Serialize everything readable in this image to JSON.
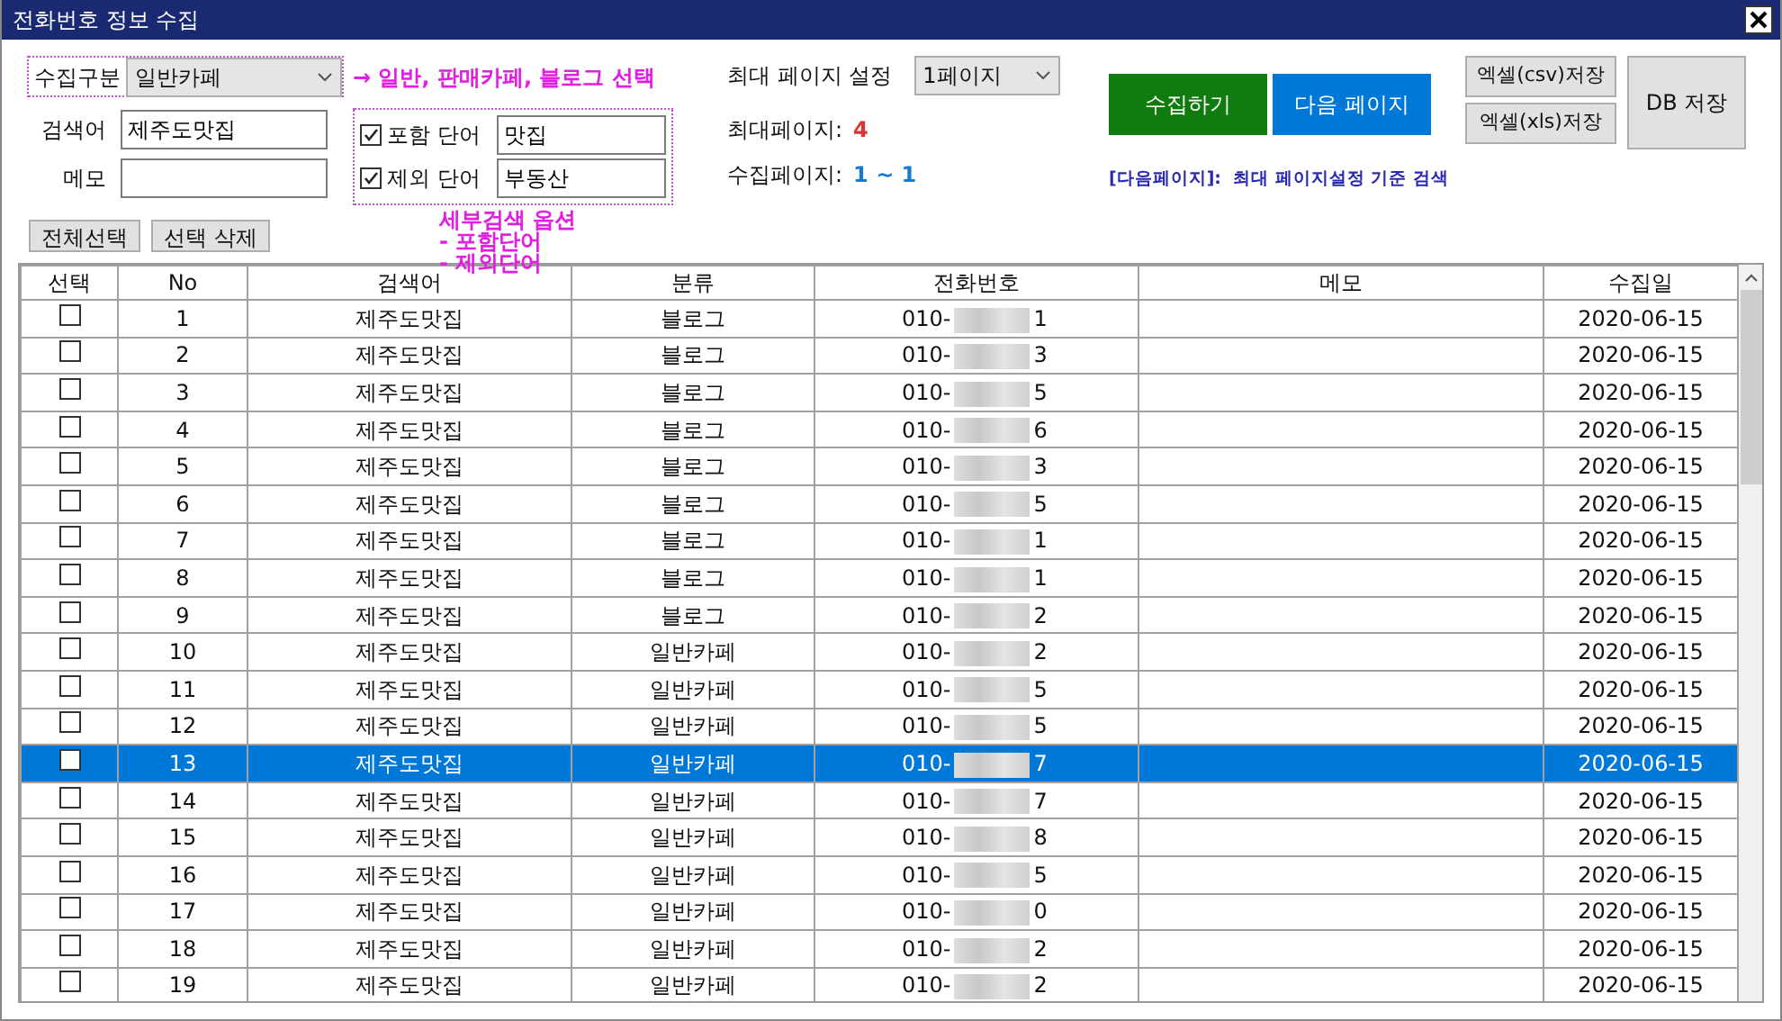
{
  "window": {
    "title": "전화번호 정보 수집"
  },
  "category": {
    "label": "수집구분",
    "value": "일반카페"
  },
  "category_note": "→ 일반, 판매카페, 블로그 선택",
  "keyword": {
    "label": "검색어",
    "value": "제주도맛집"
  },
  "memo": {
    "label": "메모"
  },
  "word_filters": [
    {
      "label": "포함 단어",
      "checked": true,
      "value": "맛집"
    },
    {
      "label": "제외 단어",
      "checked": true,
      "value": "부동산"
    }
  ],
  "detail_note": [
    "세부검색 옵션",
    "- 포함단어",
    "- 제외단어"
  ],
  "max_page_setting": {
    "label": "최대 페이지 설정",
    "value": "1페이지"
  },
  "max_page": {
    "label": "최대페이지:",
    "value": "4"
  },
  "collect_pages": {
    "label": "수집페이지:",
    "value": "1 ~ 1"
  },
  "collect_button": "수집하기",
  "next_button": "다음 페이지",
  "next_note": "[다음페이지]:  최대 페이지설정 기준 검색",
  "excel_csv_button": "엑셀(csv)저장",
  "excel_xls_button": "엑셀(xls)저장",
  "db_button": "DB 저장",
  "select_all_button": "전체선택",
  "delete_button": "선택 삭제",
  "table": {
    "columns": [
      "선택",
      "No",
      "검색어",
      "분류",
      "전화번호",
      "메모",
      "수집일"
    ],
    "rows": [
      {
        "checked": false,
        "selected": false,
        "no": "1",
        "keyword": "제주도맛집",
        "category": "블로그",
        "phone_prefix": "010-",
        "phone_suffix": "1",
        "date": "2020-06-15"
      },
      {
        "checked": false,
        "selected": false,
        "no": "2",
        "keyword": "제주도맛집",
        "category": "블로그",
        "phone_prefix": "010-",
        "phone_suffix": "3",
        "date": "2020-06-15"
      },
      {
        "checked": false,
        "selected": false,
        "no": "3",
        "keyword": "제주도맛집",
        "category": "블로그",
        "phone_prefix": "010-",
        "phone_suffix": "5",
        "date": "2020-06-15"
      },
      {
        "checked": false,
        "selected": false,
        "no": "4",
        "keyword": "제주도맛집",
        "category": "블로그",
        "phone_prefix": "010-",
        "phone_suffix": "6",
        "date": "2020-06-15"
      },
      {
        "checked": false,
        "selected": false,
        "no": "5",
        "keyword": "제주도맛집",
        "category": "블로그",
        "phone_prefix": "010-",
        "phone_suffix": "3",
        "date": "2020-06-15"
      },
      {
        "checked": false,
        "selected": false,
        "no": "6",
        "keyword": "제주도맛집",
        "category": "블로그",
        "phone_prefix": "010-",
        "phone_suffix": "5",
        "date": "2020-06-15"
      },
      {
        "checked": false,
        "selected": false,
        "no": "7",
        "keyword": "제주도맛집",
        "category": "블로그",
        "phone_prefix": "010-",
        "phone_suffix": "1",
        "date": "2020-06-15"
      },
      {
        "checked": false,
        "selected": false,
        "no": "8",
        "keyword": "제주도맛집",
        "category": "블로그",
        "phone_prefix": "010-",
        "phone_suffix": "1",
        "date": "2020-06-15"
      },
      {
        "checked": false,
        "selected": false,
        "no": "9",
        "keyword": "제주도맛집",
        "category": "블로그",
        "phone_prefix": "010-",
        "phone_suffix": "2",
        "date": "2020-06-15"
      },
      {
        "checked": false,
        "selected": false,
        "no": "10",
        "keyword": "제주도맛집",
        "category": "일반카페",
        "phone_prefix": "010-",
        "phone_suffix": "2",
        "date": "2020-06-15"
      },
      {
        "checked": false,
        "selected": false,
        "no": "11",
        "keyword": "제주도맛집",
        "category": "일반카페",
        "phone_prefix": "010-",
        "phone_suffix": "5",
        "date": "2020-06-15"
      },
      {
        "checked": false,
        "selected": false,
        "no": "12",
        "keyword": "제주도맛집",
        "category": "일반카페",
        "phone_prefix": "010-",
        "phone_suffix": "5",
        "date": "2020-06-15"
      },
      {
        "checked": false,
        "selected": true,
        "no": "13",
        "keyword": "제주도맛집",
        "category": "일반카페",
        "phone_prefix": "010-",
        "phone_suffix": "7",
        "date": "2020-06-15"
      },
      {
        "checked": false,
        "selected": false,
        "no": "14",
        "keyword": "제주도맛집",
        "category": "일반카페",
        "phone_prefix": "010-",
        "phone_suffix": "7",
        "date": "2020-06-15"
      },
      {
        "checked": false,
        "selected": false,
        "no": "15",
        "keyword": "제주도맛집",
        "category": "일반카페",
        "phone_prefix": "010-",
        "phone_suffix": "8",
        "date": "2020-06-15"
      },
      {
        "checked": false,
        "selected": false,
        "no": "16",
        "keyword": "제주도맛집",
        "category": "일반카페",
        "phone_prefix": "010-",
        "phone_suffix": "5",
        "date": "2020-06-15"
      },
      {
        "checked": false,
        "selected": false,
        "no": "17",
        "keyword": "제주도맛집",
        "category": "일반카페",
        "phone_prefix": "010-",
        "phone_suffix": "0",
        "date": "2020-06-15"
      },
      {
        "checked": false,
        "selected": false,
        "no": "18",
        "keyword": "제주도맛집",
        "category": "일반카페",
        "phone_prefix": "010-",
        "phone_suffix": "2",
        "date": "2020-06-15"
      },
      {
        "checked": false,
        "selected": false,
        "no": "19",
        "keyword": "제주도맛집",
        "category": "일반카페",
        "phone_prefix": "010-",
        "phone_suffix": "2",
        "date": "2020-06-15"
      }
    ]
  }
}
